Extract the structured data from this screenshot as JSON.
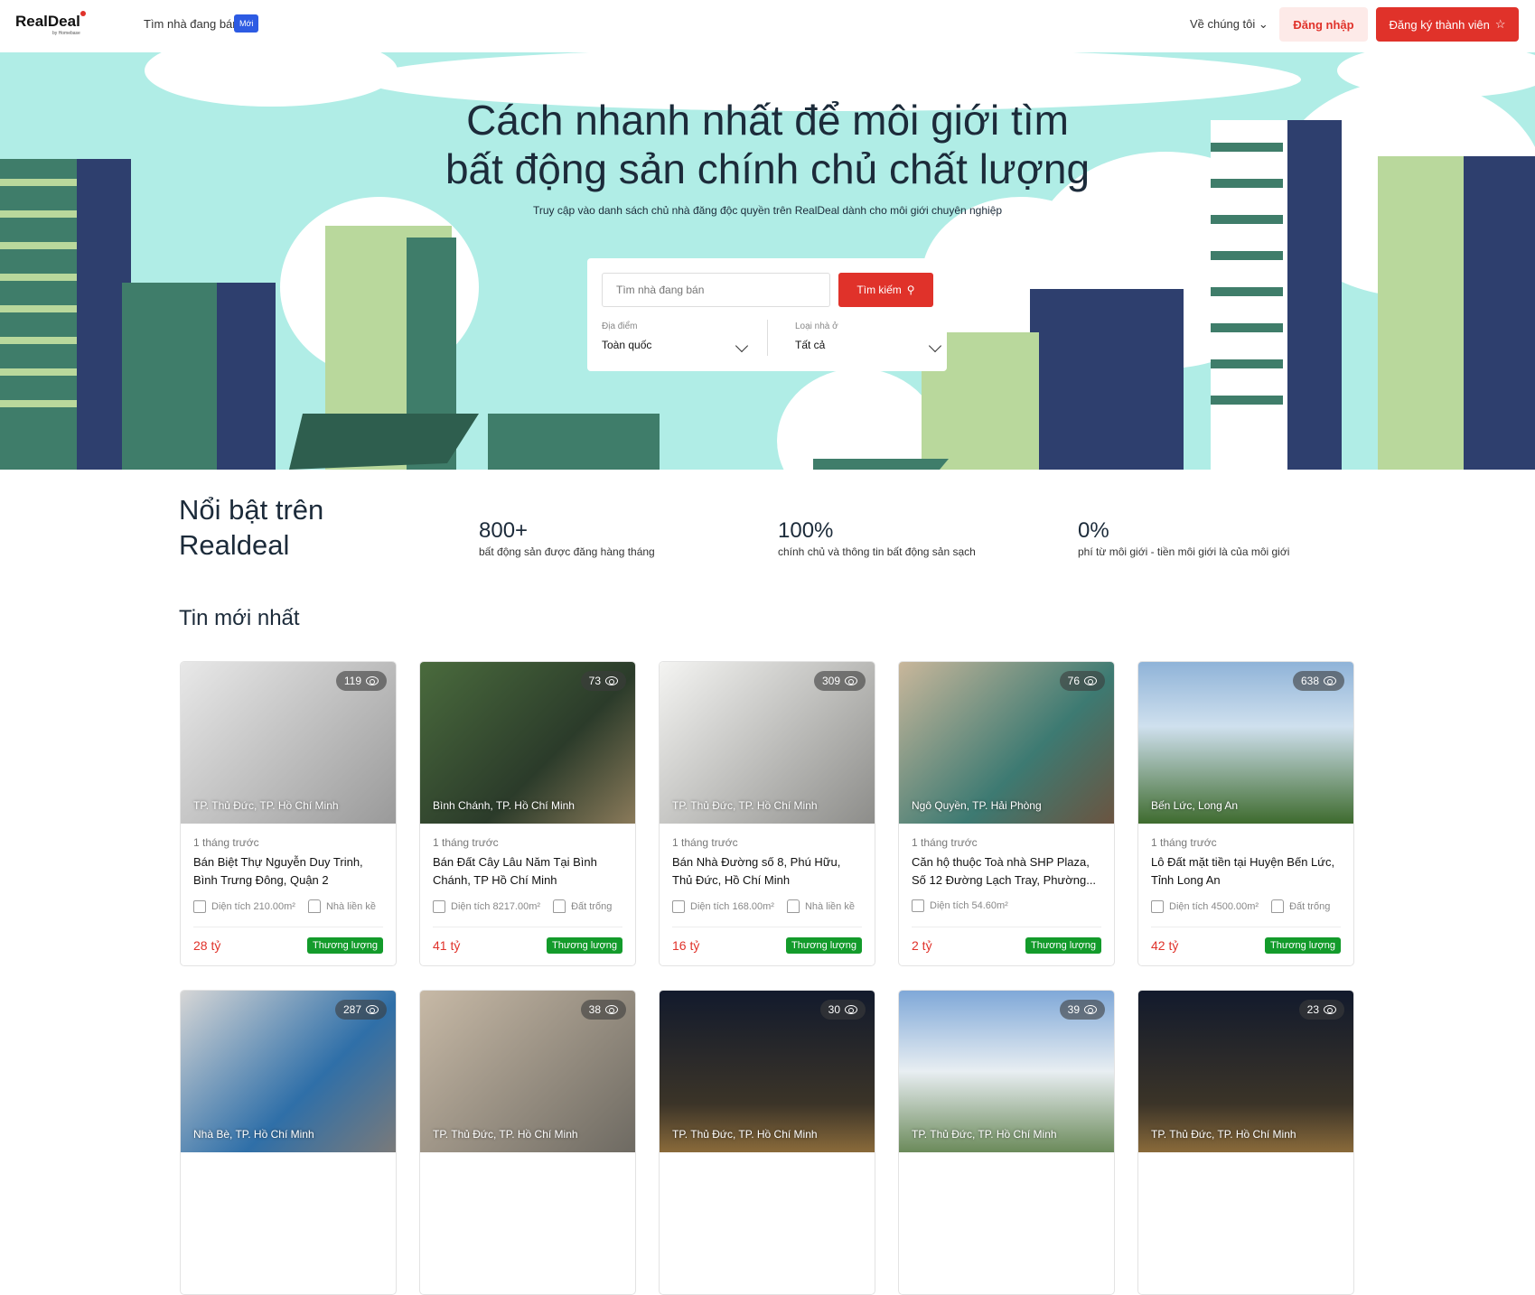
{
  "header": {
    "logo": "RealDeal",
    "logo_sub": "by Homebase",
    "nav_link": "Tìm nhà đang bán",
    "new_badge": "Mới",
    "about": "Về chúng tôi",
    "login": "Đăng nhập",
    "register": "Đăng ký thành viên"
  },
  "hero": {
    "title_line1": "Cách nhanh nhất để môi giới tìm",
    "title_line2": "bất động sản chính chủ chất lượng",
    "subtitle": "Truy cập vào danh sách chủ nhà đăng độc quyền trên RealDeal dành cho môi giới chuyên nghiệp",
    "colors": {
      "background": "#b0ede6",
      "dark_green": "#3f7d6a",
      "navy": "#2e3f6e",
      "light_green": "#b9d89c"
    }
  },
  "search": {
    "placeholder": "Tìm nhà đang bán",
    "button": "Tìm kiếm",
    "location_label": "Địa điểm",
    "location_value": "Toàn quốc",
    "type_label": "Loại nhà ở",
    "type_value": "Tất cả"
  },
  "featured": {
    "title_line1": "Nổi bật trên",
    "title_line2": "Realdeal",
    "stats": [
      {
        "num": "800+",
        "desc": "bất động sản được đăng hàng tháng"
      },
      {
        "num": "100%",
        "desc": "chính chủ và thông tin bất động sản sạch"
      },
      {
        "num": "0%",
        "desc": "phí từ môi giới - tiền môi giới là của môi giới"
      }
    ]
  },
  "latest": {
    "title": "Tin mới nhất",
    "negotiable": "Thương lượng",
    "cards": [
      {
        "views": "119",
        "location": "TP. Thủ Đức, TP. Hồ Chí Minh",
        "time": "1 tháng trước",
        "title": "Bán Biệt Thự Nguyễn Duy Trinh, Bình Trưng Đông, Quận 2",
        "area": "Diện tích 210.00m²",
        "type": "Nhà liền kề",
        "price": "28 tỷ"
      },
      {
        "views": "73",
        "location": "Bình Chánh, TP. Hồ Chí Minh",
        "time": "1 tháng trước",
        "title": "Bán Đất Cây Lâu Năm Tại Bình Chánh, TP Hồ Chí Minh",
        "area": "Diện tích 8217.00m²",
        "type": "Đất trống",
        "price": "41 tỷ"
      },
      {
        "views": "309",
        "location": "TP. Thủ Đức, TP. Hồ Chí Minh",
        "time": "1 tháng trước",
        "title": "Bán Nhà Đường số 8, Phú Hữu, Thủ Đức, Hồ Chí Minh",
        "area": "Diện tích 168.00m²",
        "type": "Nhà liền kề",
        "price": "16 tỷ"
      },
      {
        "views": "76",
        "location": "Ngô Quyền, TP. Hải Phòng",
        "time": "1 tháng trước",
        "title": "Căn hộ thuộc Toà nhà SHP Plaza, Số 12 Đường Lạch Tray, Phường...",
        "area": "Diện tích 54.60m²",
        "type": "",
        "price": "2 tỷ"
      },
      {
        "views": "638",
        "location": "Bến Lức, Long An",
        "time": "1 tháng trước",
        "title": "Lô Đất mặt tiền tại Huyện Bến Lức, Tỉnh Long An",
        "area": "Diện tích 4500.00m²",
        "type": "Đất trống",
        "price": "42 tỷ"
      },
      {
        "views": "287",
        "location": "Nhà Bè, TP. Hồ Chí Minh"
      },
      {
        "views": "38",
        "location": "TP. Thủ Đức, TP. Hồ Chí Minh"
      },
      {
        "views": "30",
        "location": "TP. Thủ Đức, TP. Hồ Chí Minh"
      },
      {
        "views": "39",
        "location": "TP. Thủ Đức, TP. Hồ Chí Minh"
      },
      {
        "views": "23",
        "location": "TP. Thủ Đức, TP. Hồ Chí Minh"
      }
    ]
  }
}
